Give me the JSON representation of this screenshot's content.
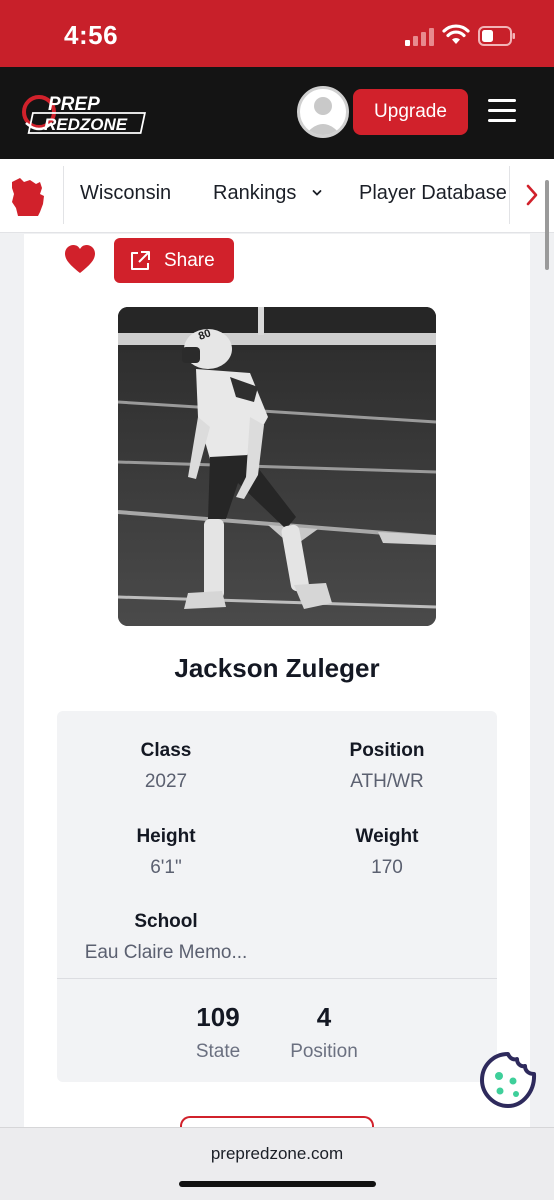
{
  "status_bar": {
    "time": "4:56"
  },
  "header": {
    "logo_line1": "PREP",
    "logo_line2": "REDZONE",
    "upgrade_label": "Upgrade"
  },
  "nav": {
    "items": [
      {
        "label": "Wisconsin"
      },
      {
        "label": "Rankings"
      },
      {
        "label": "Player Database"
      }
    ]
  },
  "actions": {
    "share_label": "Share"
  },
  "player": {
    "name": "Jackson Zuleger",
    "details": {
      "class_label": "Class",
      "class_value": "2027",
      "position_label": "Position",
      "position_value": "ATH/WR",
      "height_label": "Height",
      "height_value": "6'1\"",
      "weight_label": "Weight",
      "weight_value": "170",
      "school_label": "School",
      "school_value": "Eau Claire Memo..."
    },
    "rankings": {
      "state_rank": "109",
      "state_label": "State",
      "position_rank": "4",
      "position_label": "Position"
    },
    "photo_jersey_number": "80"
  },
  "browser": {
    "url": "prepredzone.com"
  },
  "colors": {
    "brand_red": "#d1212b",
    "header_black": "#141414",
    "cookie_purple": "#2e2a5c",
    "cookie_green": "#3ecf9a"
  },
  "icons": {
    "signal": "signal-icon",
    "wifi": "wifi-icon",
    "battery": "battery-icon",
    "heart": "heart-icon",
    "share": "share-external-icon",
    "menu": "hamburger-menu-icon",
    "chevron": "chevron-down-icon",
    "next": "chevron-right-icon",
    "cookie": "cookie-icon"
  }
}
